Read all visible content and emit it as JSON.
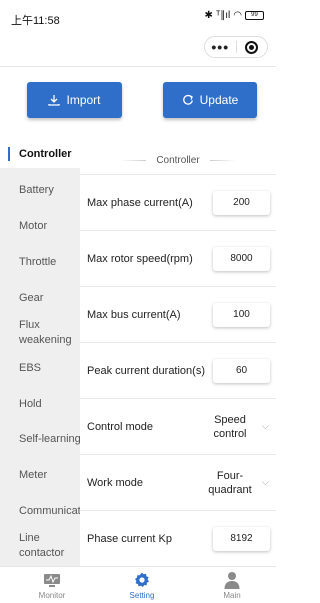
{
  "status_bar": {
    "time": "上午11:58",
    "signal_text": "ᵀ∥ıl",
    "battery": "99"
  },
  "toolbar": {
    "import_label": "Import",
    "update_label": "Update"
  },
  "colors": {
    "accent": "#2f6fc9",
    "sidebar_bg": "#efefef"
  },
  "sidebar": {
    "items": [
      {
        "label": "Controller",
        "active": true
      },
      {
        "label": "Battery"
      },
      {
        "label": "Motor"
      },
      {
        "label": "Throttle"
      },
      {
        "label": "Gear"
      },
      {
        "label": "Flux weakening"
      },
      {
        "label": "EBS"
      },
      {
        "label": "Hold"
      },
      {
        "label": "Self-learning"
      },
      {
        "label": "Meter"
      },
      {
        "label": "Communication"
      },
      {
        "label": "Line contactor"
      }
    ]
  },
  "section": {
    "title": "Controller"
  },
  "params": [
    {
      "label": "Max phase current(A)",
      "value": "200"
    },
    {
      "label": "Max rotor speed(rpm)",
      "value": "8000"
    },
    {
      "label": "Max bus current(A)",
      "value": "100"
    },
    {
      "label": "Peak current duration(s)",
      "value": "60"
    },
    {
      "label": "Control mode",
      "value": "Speed\ncontrol"
    },
    {
      "label": "Work mode",
      "value": "Four-\nquadrant"
    },
    {
      "label": "Phase current Kp",
      "value": "8192"
    }
  ],
  "tabbar": {
    "tabs": [
      {
        "label": "Monitor",
        "icon": "monitor-icon"
      },
      {
        "label": "Setting",
        "icon": "gear-icon",
        "active": true
      },
      {
        "label": "Main",
        "icon": "person-icon"
      }
    ]
  }
}
